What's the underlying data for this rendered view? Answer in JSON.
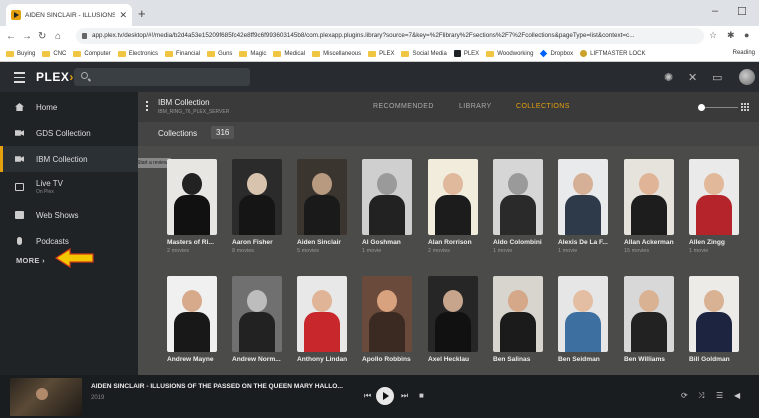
{
  "browser": {
    "tab_title": "AIDEN SINCLAIR - ILLUSIONS O",
    "url": "app.plex.tv/desktop/#!/media/b2d4a53e15209f685fc42e8ff9c6f993603145b8/com.plexapp.plugins.library?source=7&key=%2Flibrary%2Fsections%2F7%2Fcollections&pageType=list&context=c...",
    "bookmarks": [
      {
        "label": "Buying",
        "icon": "folder-icon"
      },
      {
        "label": "CNC",
        "icon": "folder-icon"
      },
      {
        "label": "Computer",
        "icon": "folder-icon"
      },
      {
        "label": "Electronics",
        "icon": "folder-icon"
      },
      {
        "label": "Financial",
        "icon": "folder-icon"
      },
      {
        "label": "Guns",
        "icon": "folder-icon"
      },
      {
        "label": "Magic",
        "icon": "folder-icon"
      },
      {
        "label": "Medical",
        "icon": "folder-icon"
      },
      {
        "label": "Miscellaneous",
        "icon": "folder-icon"
      },
      {
        "label": "PLEX",
        "icon": "folder-icon"
      },
      {
        "label": "Social Media",
        "icon": "folder-icon"
      },
      {
        "label": "PLEX",
        "icon": "plex-icon"
      },
      {
        "label": "Woodworking",
        "icon": "folder-icon"
      },
      {
        "label": "Dropbox",
        "icon": "dropbox-icon"
      },
      {
        "label": "LIFTMASTER LOCK",
        "icon": "liftmaster-icon"
      }
    ],
    "other_bookmarks": "Reading"
  },
  "plex": {
    "logo": "PLEX",
    "sidebar": {
      "items": [
        {
          "label": "Home",
          "sub": ""
        },
        {
          "label": "GDS Collection",
          "sub": ""
        },
        {
          "label": "IBM Collection",
          "sub": ""
        },
        {
          "label": "Live TV",
          "sub": "On Plex"
        },
        {
          "label": "Web Shows",
          "sub": ""
        },
        {
          "label": "Podcasts",
          "sub": ""
        }
      ],
      "more": "MORE ›"
    },
    "library": {
      "name": "IBM Collection",
      "server": "IBM_RING_76_PLEX_SERVER",
      "tabs": [
        "RECOMMENDED",
        "LIBRARY",
        "COLLECTIONS"
      ],
      "active_tab": "COLLECTIONS",
      "filter_label": "Collections",
      "count": "316",
      "tooltip": "Start a review"
    },
    "collections": [
      {
        "title": "Masters of Ri...",
        "sub": "2 movies",
        "bg": "#e8e6e2",
        "skin": "#222",
        "shirt": "#111"
      },
      {
        "title": "Aaron Fisher",
        "sub": "8 movies",
        "bg": "#2b2b2b",
        "skin": "#d8c3ae",
        "shirt": "#151515"
      },
      {
        "title": "Aiden Sinclair",
        "sub": "5 movies",
        "bg": "#3a352f",
        "skin": "#b89a80",
        "shirt": "#1a1a1a"
      },
      {
        "title": "Al Goshman",
        "sub": "1 movie",
        "bg": "#cfcfcf",
        "skin": "#9a9a9a",
        "shirt": "#222"
      },
      {
        "title": "Alan Rorrison",
        "sub": "2 movies",
        "bg": "#f2ecdd",
        "skin": "#e0b89c",
        "shirt": "#1c1c1c"
      },
      {
        "title": "Aldo Colombini",
        "sub": "1 movie",
        "bg": "#d6d6d6",
        "skin": "#9a9a9a",
        "shirt": "#2a2a2a"
      },
      {
        "title": "Alexis De La F...",
        "sub": "1 movie",
        "bg": "#e9eaec",
        "skin": "#d6b096",
        "shirt": "#2e3a4a"
      },
      {
        "title": "Allan Ackerman",
        "sub": "15 movies",
        "bg": "#e6e2dc",
        "skin": "#e0b496",
        "shirt": "#1d1d1d"
      },
      {
        "title": "Allen Zingg",
        "sub": "1 movie",
        "bg": "#eaeaea",
        "skin": "#e2b89a",
        "shirt": "#b4242a"
      },
      {
        "title": "Andrew Mayne",
        "sub": "",
        "bg": "#f0f0f0",
        "skin": "#d7aa8c",
        "shirt": "#181818"
      },
      {
        "title": "Andrew Norm...",
        "sub": "",
        "bg": "#707070",
        "skin": "#bdbdbd",
        "shirt": "#222"
      },
      {
        "title": "Anthony Lindan",
        "sub": "",
        "bg": "#e8e8e8",
        "skin": "#e0b496",
        "shirt": "#c8282c"
      },
      {
        "title": "Apollo Robbins",
        "sub": "",
        "bg": "#6a4a3a",
        "skin": "#d9a27e",
        "shirt": "#3a2a22"
      },
      {
        "title": "Axel Hecklau",
        "sub": "",
        "bg": "#262626",
        "skin": "#c7a48c",
        "shirt": "#111"
      },
      {
        "title": "Ben Salinas",
        "sub": "",
        "bg": "#d8d4ce",
        "skin": "#d4a888",
        "shirt": "#1b1b1b"
      },
      {
        "title": "Ben Seidman",
        "sub": "",
        "bg": "#e6e6e6",
        "skin": "#e3bea2",
        "shirt": "#3d6fa0"
      },
      {
        "title": "Ben Williams",
        "sub": "",
        "bg": "#d8d8d8",
        "skin": "#d9b294",
        "shirt": "#222"
      },
      {
        "title": "Bill Goldman",
        "sub": "",
        "bg": "#ecebe8",
        "skin": "#d9b294",
        "shirt": "#1c2440"
      }
    ],
    "player": {
      "title": "AIDEN SINCLAIR - ILLUSIONS OF THE PASSED ON THE QUEEN MARY HALLO...",
      "year": "2019"
    }
  },
  "colors": {
    "accent": "#e5a00d",
    "arrow": "#f3c800"
  }
}
